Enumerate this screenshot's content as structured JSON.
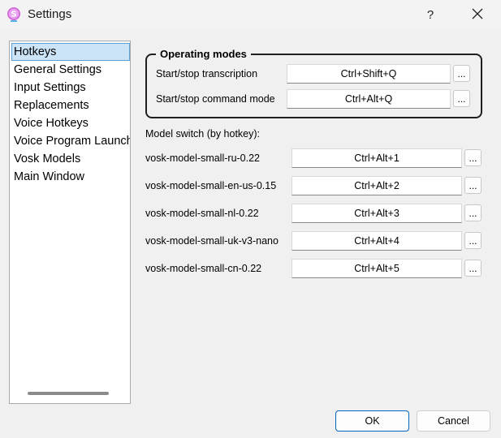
{
  "window": {
    "title": "Settings",
    "help_label": "?"
  },
  "nav": {
    "items": [
      {
        "label": "Hotkeys",
        "selected": true
      },
      {
        "label": "General Settings"
      },
      {
        "label": "Input Settings"
      },
      {
        "label": "Replacements"
      },
      {
        "label": "Voice Hotkeys"
      },
      {
        "label": "Voice Program Launch"
      },
      {
        "label": "Vosk Models"
      },
      {
        "label": "Main Window"
      }
    ]
  },
  "operating_modes": {
    "title": "Operating modes",
    "rows": [
      {
        "label": "Start/stop transcription",
        "hotkey": "Ctrl+Shift+Q",
        "button": "..."
      },
      {
        "label": "Start/stop command mode",
        "hotkey": "Ctrl+Alt+Q",
        "button": "..."
      }
    ]
  },
  "model_switch": {
    "title": "Model switch (by hotkey):",
    "rows": [
      {
        "label": "vosk-model-small-ru-0.22",
        "hotkey": "Ctrl+Alt+1",
        "button": "..."
      },
      {
        "label": "vosk-model-small-en-us-0.15",
        "hotkey": "Ctrl+Alt+2",
        "button": "..."
      },
      {
        "label": "vosk-model-small-nl-0.22",
        "hotkey": "Ctrl+Alt+3",
        "button": "..."
      },
      {
        "label": "vosk-model-small-uk-v3-nano",
        "hotkey": "Ctrl+Alt+4",
        "button": "..."
      },
      {
        "label": "vosk-model-small-cn-0.22",
        "hotkey": "Ctrl+Alt+5",
        "button": "..."
      }
    ]
  },
  "footer": {
    "ok_label": "OK",
    "cancel_label": "Cancel"
  },
  "icons": {
    "app": "app-logo-icon",
    "close": "close-icon"
  },
  "colors": {
    "accent": "#0067c0",
    "selection": "#cce4f7"
  }
}
